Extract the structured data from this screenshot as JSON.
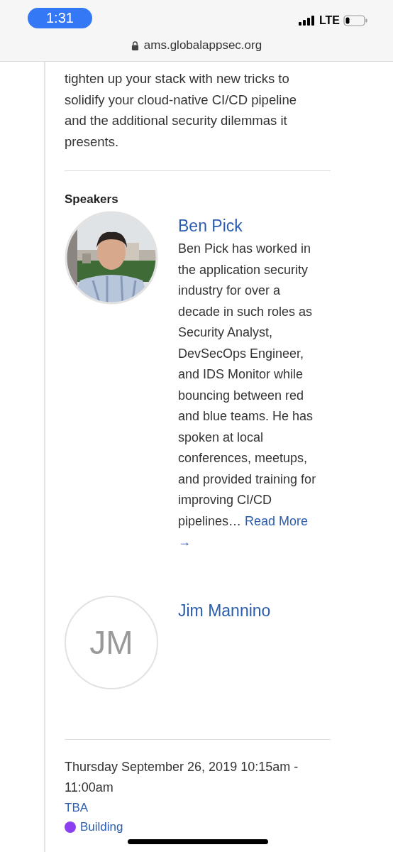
{
  "status_bar": {
    "time": "1:31",
    "network": "LTE"
  },
  "address_bar": {
    "url": "ams.globalappsec.org"
  },
  "description": "tighten up your stack with new tricks to solidify your cloud-native CI/CD pipeline and the additional security dilemmas it presents.",
  "speakers_heading": "Speakers",
  "speakers": [
    {
      "name": "Ben Pick",
      "bio": "Ben Pick has worked in the application security industry for over a decade in such roles as Security Analyst, DevSecOps Engineer, and IDS Monitor while bouncing between red and blue teams. He has spoken at local conferences, meetups, and provided training for improving CI/CD pipelines…",
      "read_more": "Read More",
      "read_more_arrow": "→"
    },
    {
      "name": "Jim Mannino",
      "avatar": {
        "kind": "initials",
        "initials": "JM"
      }
    }
  ],
  "schedule": {
    "time": "Thursday September 26, 2019 10:15am - 11:00am",
    "venue": "TBA",
    "tag": {
      "label": "Building",
      "color": "#8c3ff0"
    }
  }
}
